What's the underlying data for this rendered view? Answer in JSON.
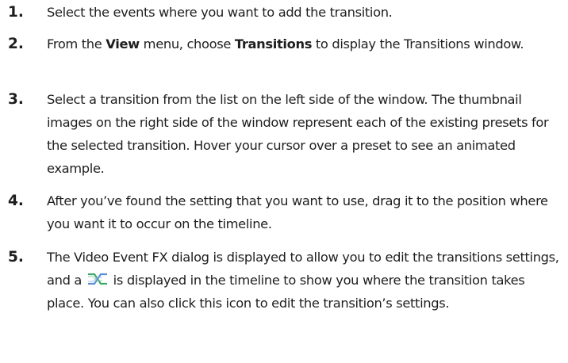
{
  "steps": [
    {
      "number": "1.",
      "text": "Select the events where you want to add the transition."
    },
    {
      "number": "2.",
      "pre": "From the ",
      "bold1": "View",
      "mid": " menu, choose ",
      "bold2": "Transitions",
      "post": " to display the Transitions window."
    },
    {
      "number": "3.",
      "text": "Select a transition from the list on the left side of the window. The thumbnail images on the right side of the window represent each of the existing presets for the selected transition. Hover your cursor over a preset to see an animated example."
    },
    {
      "number": "4.",
      "text": "After you’ve found the setting that you want to use, drag it to the position where you want it to occur on the timeline."
    },
    {
      "number": "5.",
      "pre": "The Video Event FX dialog is displayed to allow you to edit the transitions settings, and a ",
      "icon": "transition-icon",
      "post": " is displayed in the timeline to show you where the transition takes place. You can also click this icon to edit the transition’s settings."
    }
  ],
  "colors": {
    "text": "#1e1e1e",
    "icon_green": "#3fa86a",
    "icon_blue": "#5a8fd6"
  }
}
